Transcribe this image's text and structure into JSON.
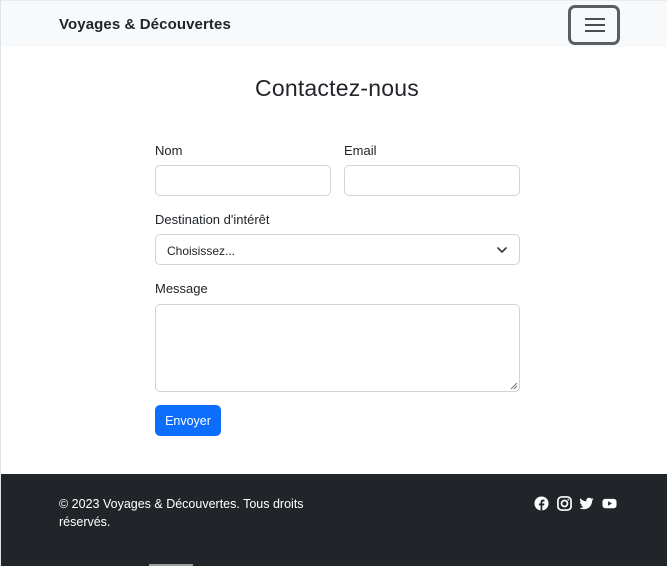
{
  "navbar": {
    "brand": "Voyages & Découvertes",
    "toggler_icon": "hamburger-menu-icon"
  },
  "form": {
    "title": "Contactez-nous",
    "name_label": "Nom",
    "name_value": "",
    "email_label": "Email",
    "email_value": "",
    "destination_label": "Destination d'intérêt",
    "destination_selected": "Choisissez...",
    "message_label": "Message",
    "message_value": "",
    "submit_label": "Envoyer",
    "accent_color": "#0d6efd"
  },
  "footer": {
    "copyright": "© 2023 Voyages & Découvertes. Tous droits réservés.",
    "social_icons": [
      "facebook-icon",
      "instagram-icon",
      "twitter-icon",
      "youtube-icon"
    ],
    "background_color": "#212529"
  }
}
